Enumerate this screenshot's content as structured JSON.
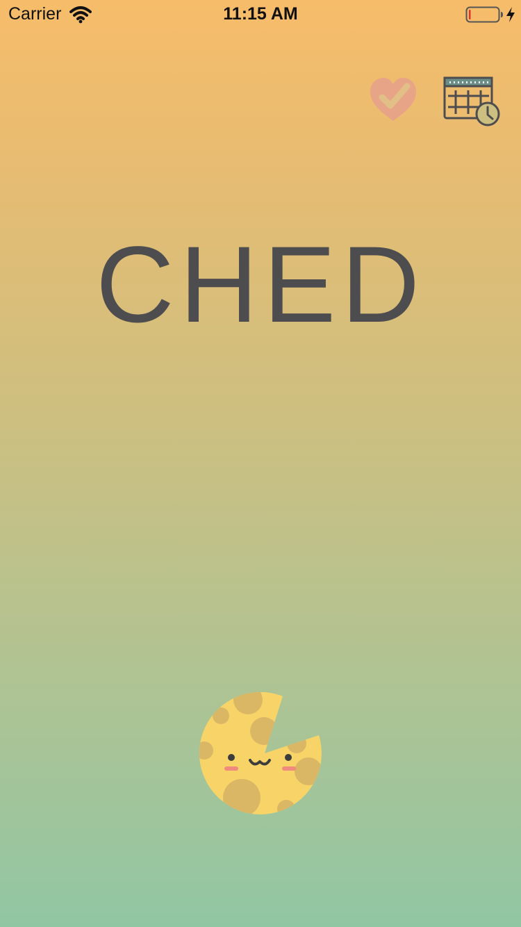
{
  "status_bar": {
    "carrier": "Carrier",
    "time": "11:15 AM",
    "battery_level": 0.05,
    "charging": true
  },
  "header": {
    "favorites_icon": "heart-check-icon",
    "schedule_icon": "calendar-clock-icon"
  },
  "main": {
    "title": "CHED",
    "mascot_icon": "cheese-face-icon"
  },
  "colors": {
    "background_top": "#f6bc6a",
    "background_bottom": "#91c6a3",
    "title": "#4d4d4f",
    "heart": "#e8a487",
    "cheese": "#f8d468",
    "cheese_holes": "#d9b765",
    "cheek": "#ef8a7d"
  }
}
